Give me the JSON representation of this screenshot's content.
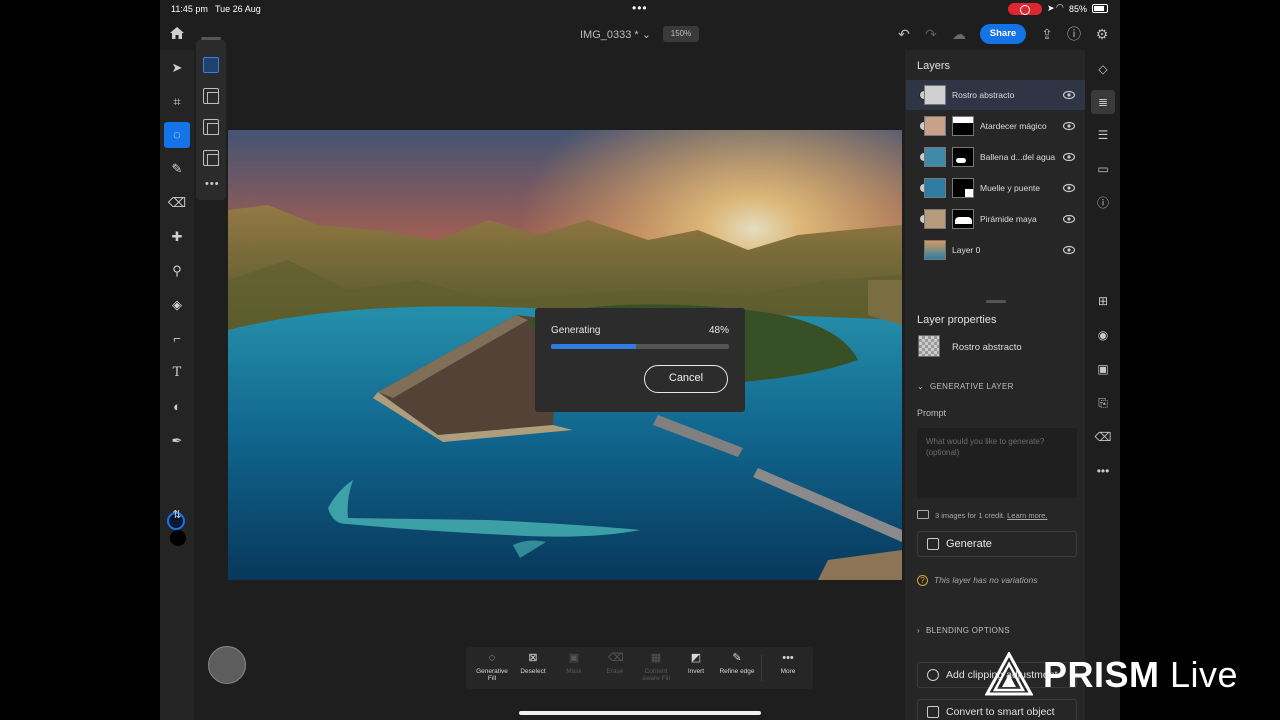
{
  "status_bar": {
    "time": "11:45 pm",
    "date": "Tue 26 Aug",
    "battery": "85%",
    "battery_level": 0.85
  },
  "top_bar": {
    "doc_title": "IMG_0333 *",
    "zoom": "150%",
    "share_label": "Share"
  },
  "toolbar": {
    "tools": [
      "move-tool-icon",
      "transform-tool-icon",
      "lasso-select-icon",
      "brush-icon",
      "eraser-icon",
      "healing-brush-icon",
      "clone-stamp-icon",
      "paint-bucket-icon",
      "crop-icon",
      "type-icon",
      "adjustment-icon",
      "eyedropper-icon"
    ],
    "active_tool": "lasso-select-icon",
    "foreground_color": "#0a1730",
    "background_color": "#000000"
  },
  "generating_dialog": {
    "label": "Generating",
    "percent_text": "48%",
    "progress": 0.48,
    "cancel_label": "Cancel"
  },
  "layers_panel": {
    "title": "Layers",
    "layers": [
      {
        "name": "Rostro abstracto",
        "selected": true,
        "has_mask": false
      },
      {
        "name": "Atardecer mágico",
        "selected": false,
        "has_mask": true
      },
      {
        "name": "Ballena d...del agua",
        "selected": false,
        "has_mask": true
      },
      {
        "name": "Muelle y puente",
        "selected": false,
        "has_mask": true
      },
      {
        "name": "Pirámide maya",
        "selected": false,
        "has_mask": true
      },
      {
        "name": "Layer 0",
        "selected": false,
        "has_mask": false
      }
    ]
  },
  "layer_properties": {
    "title": "Layer properties",
    "layer_name": "Rostro abstracto",
    "generative_section": "GENERATIVE LAYER",
    "prompt_label": "Prompt",
    "prompt_placeholder": "What would you like to generate? (optional)",
    "credits_text": "3 images for 1 credit.",
    "learn_more": "Learn more.",
    "generate_label": "Generate",
    "variations_note": "This layer has no variations",
    "blending_section": "BLENDING OPTIONS",
    "add_clipping_label": "Add clipping adjustment",
    "convert_label": "Convert to smart object"
  },
  "context_bar": {
    "items": [
      {
        "icon": "generative-fill-icon",
        "label": "Generative Fill",
        "enabled": true
      },
      {
        "icon": "deselect-icon",
        "label": "Deselect",
        "enabled": true
      },
      {
        "icon": "mask-icon",
        "label": "Mask",
        "enabled": false
      },
      {
        "icon": "erase-icon",
        "label": "Erase",
        "enabled": false
      },
      {
        "icon": "content-aware-fill-icon",
        "label": "Content aware Fill",
        "enabled": false
      },
      {
        "icon": "invert-icon",
        "label": "Invert",
        "enabled": true
      },
      {
        "icon": "refine-edge-icon",
        "label": "Refine edge",
        "enabled": true
      },
      {
        "icon": "more-icon",
        "label": "More",
        "enabled": true
      }
    ]
  },
  "watermark": {
    "brand_bold": "PRISM",
    "brand_light": " Live"
  }
}
